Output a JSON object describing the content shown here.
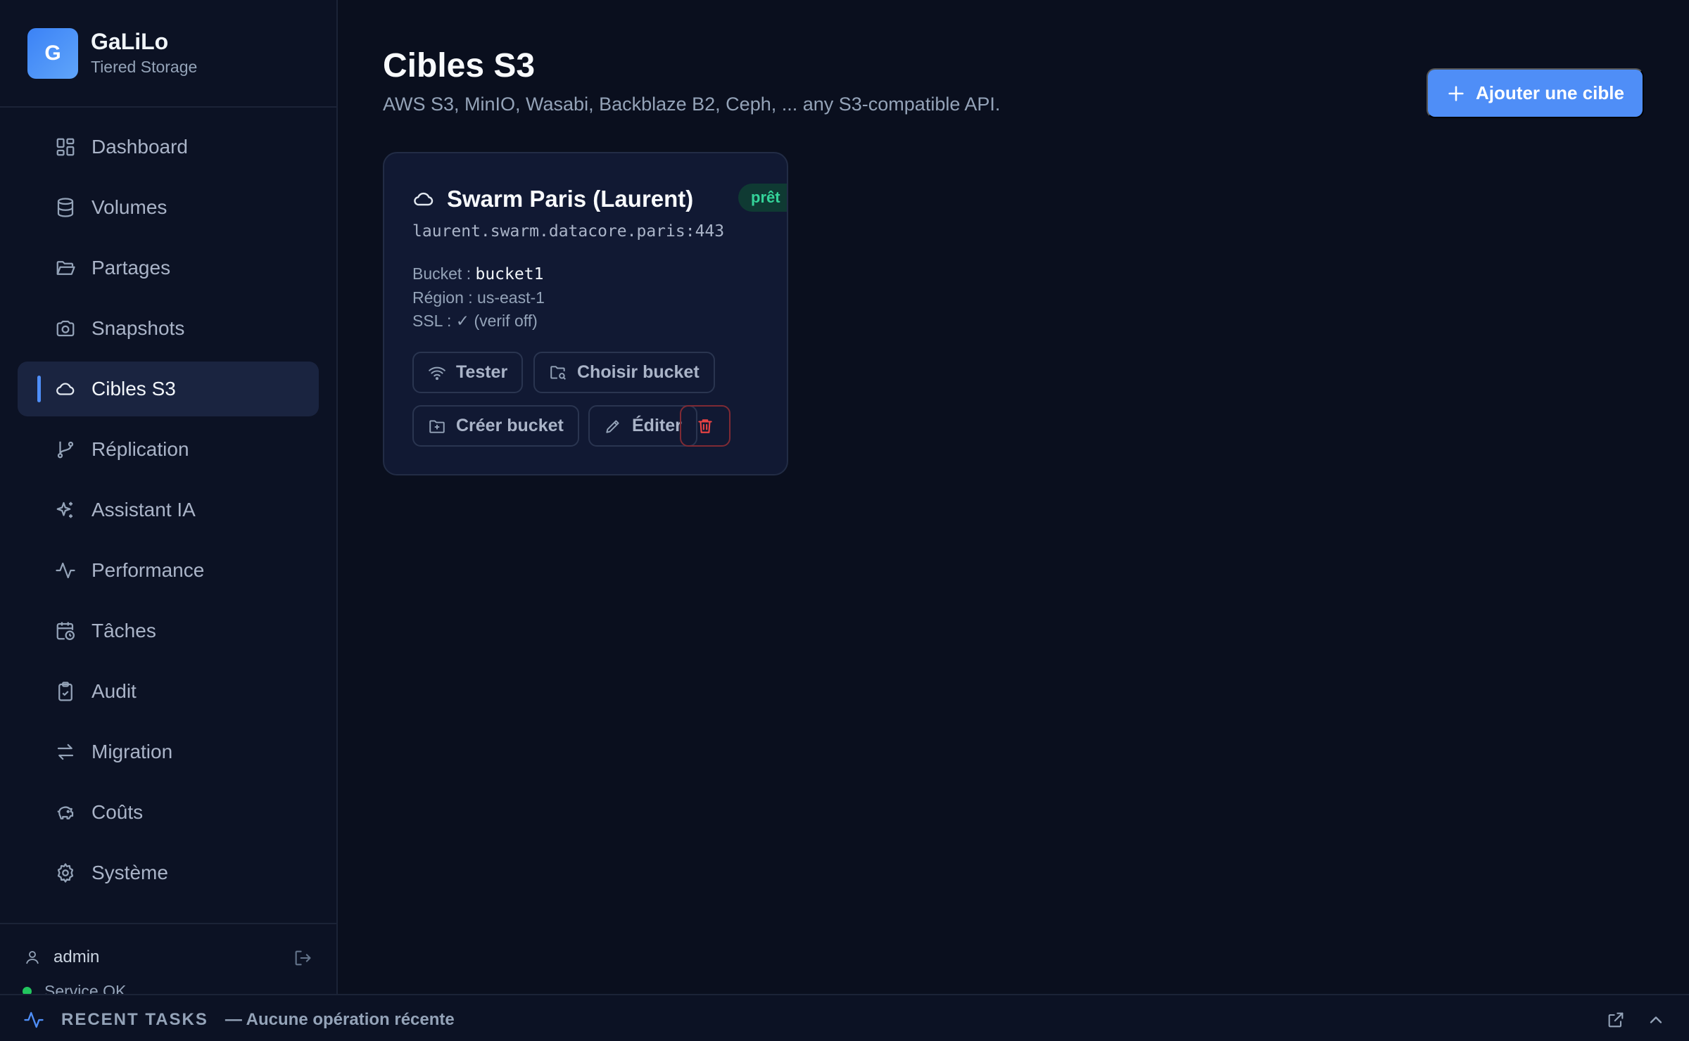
{
  "brand": {
    "logo_letter": "G",
    "name": "GaLiLo",
    "subtitle": "Tiered Storage"
  },
  "sidebar": {
    "items": [
      {
        "label": "Dashboard",
        "icon": "dashboard-icon"
      },
      {
        "label": "Volumes",
        "icon": "database-icon"
      },
      {
        "label": "Partages",
        "icon": "folder-open-icon"
      },
      {
        "label": "Snapshots",
        "icon": "camera-icon"
      },
      {
        "label": "Cibles S3",
        "icon": "cloud-icon",
        "active": true
      },
      {
        "label": "Réplication",
        "icon": "git-branch-icon"
      },
      {
        "label": "Assistant IA",
        "icon": "sparkles-icon"
      },
      {
        "label": "Performance",
        "icon": "activity-icon"
      },
      {
        "label": "Tâches",
        "icon": "calendar-clock-icon"
      },
      {
        "label": "Audit",
        "icon": "clipboard-check-icon"
      },
      {
        "label": "Migration",
        "icon": "arrows-swap-icon"
      },
      {
        "label": "Coûts",
        "icon": "piggy-bank-icon"
      },
      {
        "label": "Système",
        "icon": "gear-icon"
      }
    ],
    "footer": {
      "user": "admin",
      "service_status": "Service OK"
    }
  },
  "page": {
    "title": "Cibles S3",
    "subtitle": "AWS S3, MinIO, Wasabi, Backblaze B2, Ceph, ... any S3-compatible API.",
    "add_button": "Ajouter une cible"
  },
  "target_card": {
    "name": "Swarm Paris (Laurent)",
    "status": "prêt",
    "endpoint": "laurent.swarm.datacore.paris:443",
    "bucket_label": "Bucket : ",
    "bucket_value": "bucket1",
    "region_text": "Région : us-east-1",
    "ssl_text": "SSL : ✓ (verif off)",
    "actions": {
      "test": "Tester",
      "choose_bucket": "Choisir bucket",
      "create_bucket": "Créer bucket",
      "edit": "Éditer"
    }
  },
  "taskbar": {
    "label": "RECENT TASKS",
    "status": "— Aucune opération récente"
  },
  "colors": {
    "accent": "#4f8ef7",
    "ready": "#34d399",
    "danger": "#ef4444",
    "background": "#0a0f1e"
  }
}
